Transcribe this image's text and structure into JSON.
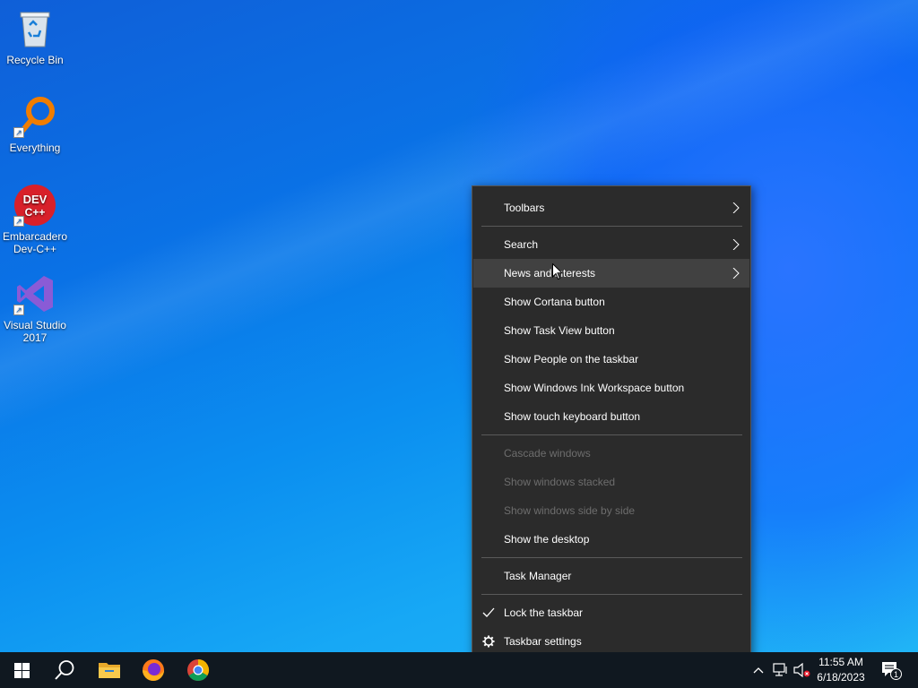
{
  "desktop": {
    "icons": [
      {
        "label": "Recycle Bin",
        "icon": "recycle-bin-icon"
      },
      {
        "label": "Everything",
        "icon": "everything-search-icon"
      },
      {
        "label": "Embarcadero Dev-C++",
        "icon": "devcpp-icon",
        "badge": "DEV C++"
      },
      {
        "label": "Visual Studio 2017",
        "icon": "visual-studio-icon"
      }
    ]
  },
  "context_menu": {
    "items": [
      {
        "label": "Toolbars",
        "submenu": true,
        "enabled": true
      },
      {
        "label": "Search",
        "submenu": true,
        "enabled": true
      },
      {
        "label": "News and interests",
        "submenu": true,
        "enabled": true,
        "highlighted": true
      },
      {
        "label": "Show Cortana button",
        "enabled": true
      },
      {
        "label": "Show Task View button",
        "enabled": true
      },
      {
        "label": "Show People on the taskbar",
        "enabled": true
      },
      {
        "label": "Show Windows Ink Workspace button",
        "enabled": true
      },
      {
        "label": "Show touch keyboard button",
        "enabled": true
      },
      {
        "label": "Cascade windows",
        "enabled": false
      },
      {
        "label": "Show windows stacked",
        "enabled": false
      },
      {
        "label": "Show windows side by side",
        "enabled": false
      },
      {
        "label": "Show the desktop",
        "enabled": true
      },
      {
        "label": "Task Manager",
        "enabled": true
      },
      {
        "label": "Lock the taskbar",
        "enabled": true,
        "checked": true
      },
      {
        "label": "Taskbar settings",
        "enabled": true,
        "icon": "gear-icon"
      }
    ]
  },
  "taskbar": {
    "buttons": [
      "start-icon",
      "search-icon",
      "file-explorer-icon",
      "firefox-icon",
      "chrome-icon"
    ],
    "tray": {
      "time": "11:55 AM",
      "date": "6/18/2023",
      "notification_count": "1"
    }
  },
  "colors": {
    "menu_bg": "#2b2b2b",
    "menu_hover": "#414141",
    "menu_disabled_text": "#6d6d6d",
    "taskbar_bg": "#101820"
  }
}
